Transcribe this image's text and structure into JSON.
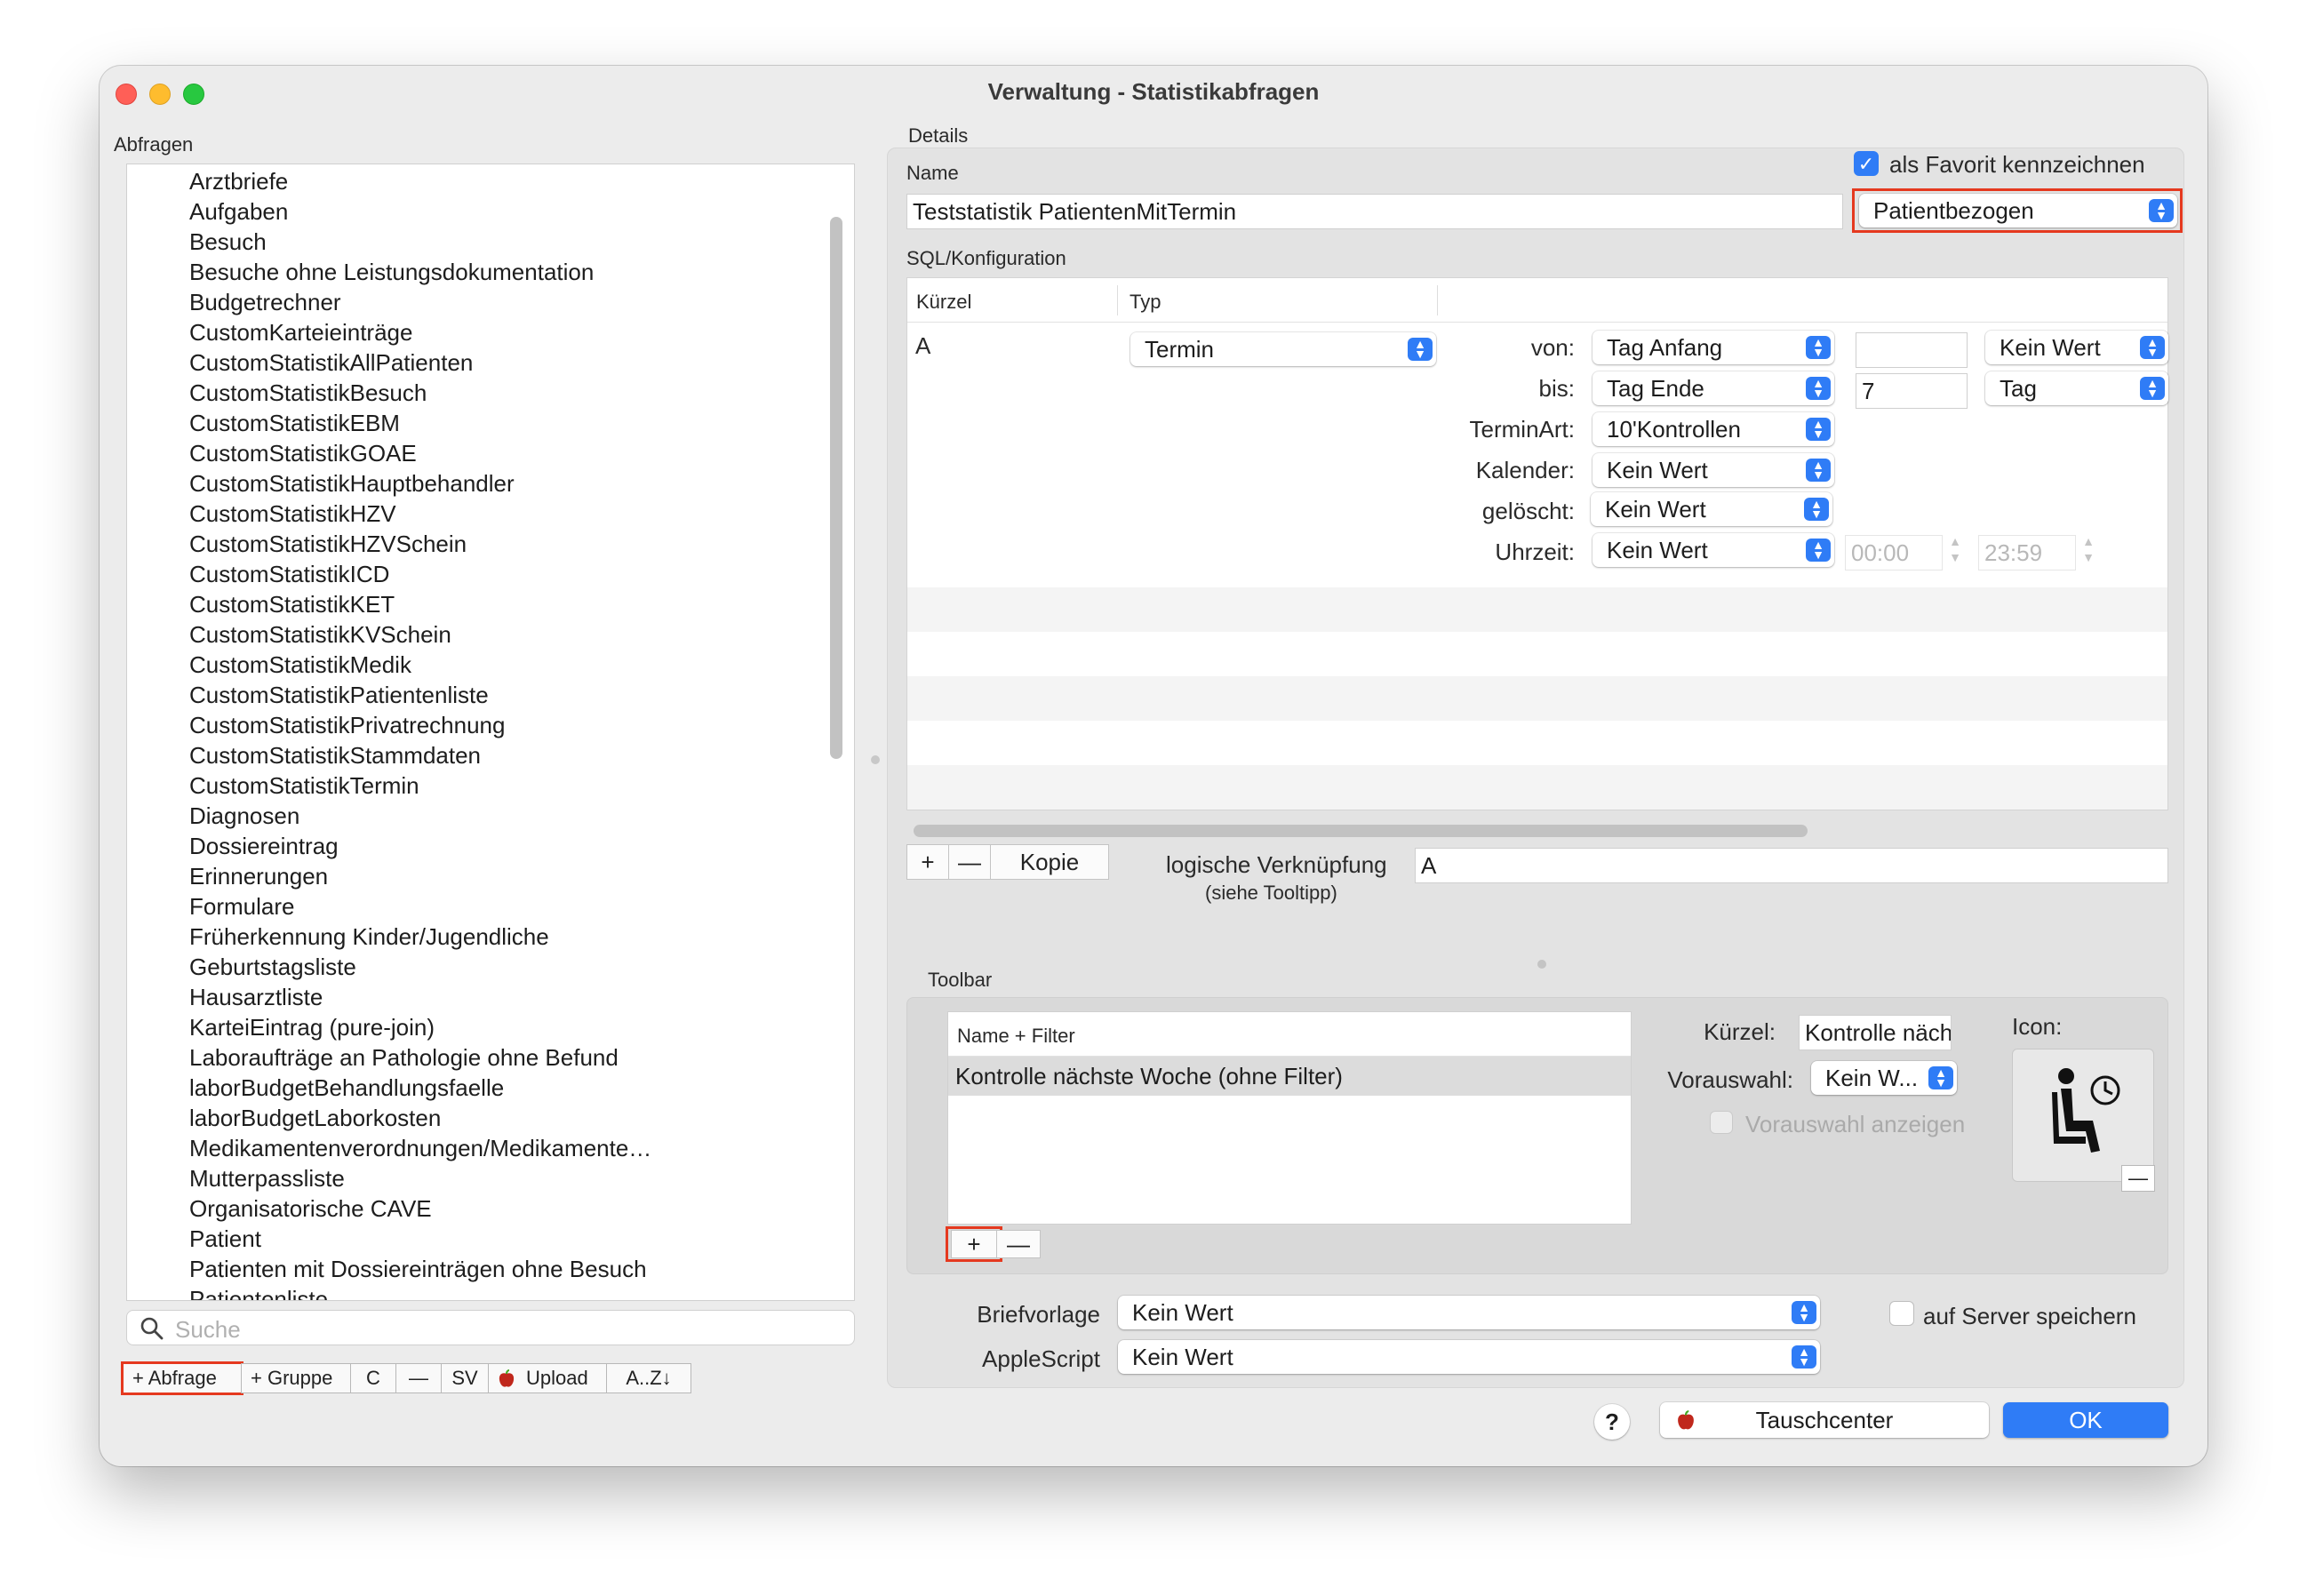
{
  "window": {
    "title": "Verwaltung - Statistikabfragen"
  },
  "left": {
    "section_label": "Abfragen",
    "items": [
      "Arztbriefe",
      "Aufgaben",
      "Besuch",
      "Besuche ohne Leistungsdokumentation",
      "Budgetrechner",
      "CustomKarteieinträge",
      "CustomStatistikAllPatienten",
      "CustomStatistikBesuch",
      "CustomStatistikEBM",
      "CustomStatistikGOAE",
      "CustomStatistikHauptbehandler",
      "CustomStatistikHZV",
      "CustomStatistikHZVSchein",
      "CustomStatistikICD",
      "CustomStatistikKET",
      "CustomStatistikKVSchein",
      "CustomStatistikMedik",
      "CustomStatistikPatientenliste",
      "CustomStatistikPrivatrechnung",
      "CustomStatistikStammdaten",
      "CustomStatistikTermin",
      "Diagnosen",
      "Dossiereintrag",
      "Erinnerungen",
      "Formulare",
      "Früherkennung Kinder/Jugendliche",
      "Geburtstagsliste",
      "Hausarztliste",
      "KarteiEintrag (pure-join)",
      "Laboraufträge an Pathologie ohne Befund",
      "laborBudgetBehandlungsfaelle",
      "laborBudgetLaborkosten",
      "Medikamentenverordnungen/Medikamente…",
      "Mutterpassliste",
      "Organisatorische CAVE",
      "Patient",
      "Patienten mit Dossiereinträgen ohne Besuch",
      "Patientenliste"
    ],
    "search_placeholder": "Suche",
    "buttons": {
      "add_query": "+ Abfrage",
      "add_group": "+ Gruppe",
      "copy": "C",
      "remove": "—",
      "sv": "SV",
      "upload": "Upload",
      "sort": "A..Z↓"
    }
  },
  "details": {
    "section_label": "Details",
    "name_label": "Name",
    "name_value": "Teststatistik PatientenMitTermin",
    "favorite_label": "als Favorit kennzeichnen",
    "favorite_checked": true,
    "scope_value": "Patientbezogen",
    "sql_label": "SQL/Konfiguration",
    "table_headers": {
      "kuerzel": "Kürzel",
      "typ": "Typ"
    },
    "row": {
      "kuerzel": "A",
      "typ": "Termin"
    },
    "params": {
      "von": {
        "label": "von:",
        "value": "Tag Anfang",
        "num": "",
        "unit": "Kein Wert"
      },
      "bis": {
        "label": "bis:",
        "value": "Tag Ende",
        "num": "7",
        "unit": "Tag"
      },
      "terminart": {
        "label": "TerminArt:",
        "value": "10'Kontrollen"
      },
      "kalender": {
        "label": "Kalender:",
        "value": "Kein Wert"
      },
      "geloescht": {
        "label": "gelöscht:",
        "value": "Kein Wert"
      },
      "uhrzeit": {
        "label": "Uhrzeit:",
        "value": "Kein Wert",
        "from": "00:00",
        "to": "23:59"
      }
    },
    "seg_add": "+",
    "seg_remove": "—",
    "seg_copy": "Kopie",
    "logic_label": "logische Verknüpfung",
    "logic_hint": "(siehe Tooltipp)",
    "logic_value": "A"
  },
  "toolbar": {
    "section_label": "Toolbar",
    "list_header": "Name + Filter",
    "list_items": [
      "Kontrolle nächste Woche (ohne Filter)"
    ],
    "kuerzel_label": "Kürzel:",
    "kuerzel_value": "Kontrolle näch",
    "vorauswahl_label": "Vorauswahl:",
    "vorauswahl_value": "Kein W...",
    "vorauswahl_show_label": "Vorauswahl anzeigen",
    "icon_label": "Icon:",
    "add": "+",
    "remove": "—"
  },
  "bottom": {
    "briefvorlage_label": "Briefvorlage",
    "briefvorlage_value": "Kein Wert",
    "applescript_label": "AppleScript",
    "applescript_value": "Kein Wert",
    "server_label": "auf Server speichern",
    "help": "?",
    "tauschcenter": "Tauschcenter",
    "ok": "OK"
  },
  "colors": {
    "accent": "#2f7cf6",
    "highlight_box": "#e5391f"
  }
}
